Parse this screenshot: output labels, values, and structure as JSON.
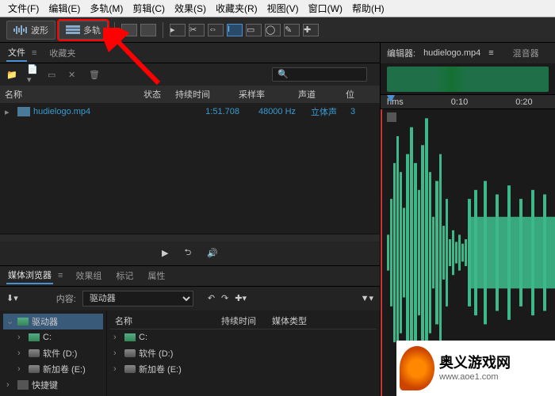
{
  "menu": [
    "文件(F)",
    "编辑(E)",
    "多轨(M)",
    "剪辑(C)",
    "效果(S)",
    "收藏夹(R)",
    "视图(V)",
    "窗口(W)",
    "帮助(H)"
  ],
  "toolbar": {
    "waveform": "波形",
    "multitrack": "多轨"
  },
  "panels": {
    "files_tab": "文件",
    "fav_tab": "收藏夹",
    "cols": {
      "name": "名称",
      "status": "状态",
      "duration": "持续时间",
      "rate": "采样率",
      "channels": "声道",
      "pos": "位"
    },
    "file": {
      "name": "hudielogo.mp4",
      "duration": "1:51.708",
      "rate": "48000 Hz",
      "channels": "立体声",
      "pos": "3"
    }
  },
  "browser": {
    "tab1": "媒体浏览器",
    "tab2": "效果组",
    "tab3": "标记",
    "tab4": "属性",
    "content_label": "内容:",
    "drive_sel": "驱动器",
    "tree": {
      "drives": "驱动器",
      "c": "C:",
      "d": "软件 (D:)",
      "e": "新加卷 (E:)",
      "shortcuts": "快捷键"
    },
    "cols": {
      "name": "名称",
      "duration": "持续时间",
      "type": "媒体类型"
    }
  },
  "editor": {
    "label": "编辑器:",
    "file": "hudielogo.mp4",
    "mixer": "混音器"
  },
  "timeline": {
    "unit": "hms",
    "t1": "0:10",
    "t2": "0:20"
  },
  "watermark": {
    "title": "奥义游戏网",
    "url": "www.aoe1.com"
  }
}
